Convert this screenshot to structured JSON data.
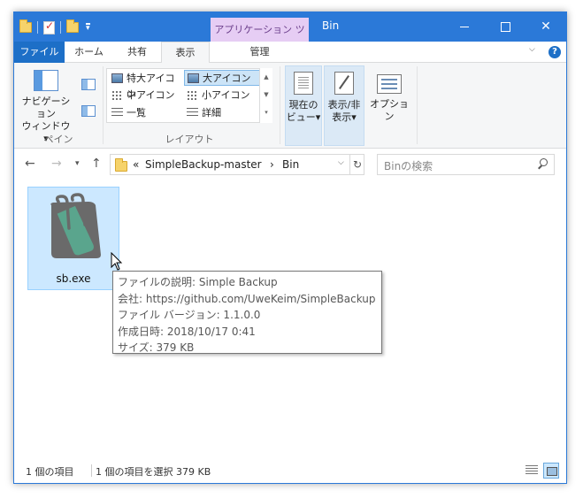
{
  "title_bar": {
    "window_title": "Bin",
    "context_tab_group": "アプリケーション ツール"
  },
  "ribbon_tabs": {
    "file": "ファイル",
    "home": "ホーム",
    "share": "共有",
    "view": "表示",
    "manage": "管理"
  },
  "ribbon": {
    "pane_group": {
      "label": "ペイン",
      "nav_pane_line1": "ナビゲーション",
      "nav_pane_line2": "ウィンドウ▾"
    },
    "layout_group": {
      "label": "レイアウト",
      "items": [
        "特大アイコン",
        "大アイコン",
        "中アイコン",
        "小アイコン",
        "一覧",
        "詳細"
      ],
      "selected": "大アイコン"
    },
    "current_view": {
      "line1": "現在の",
      "line2": "ビュー▾"
    },
    "show_hide": {
      "line1": "表示/非",
      "line2": "表示▾"
    },
    "options": {
      "label": "オプション"
    }
  },
  "address_bar": {
    "overflow": "«",
    "crumbs": [
      "SimpleBackup-master",
      "Bin"
    ],
    "separator": "›"
  },
  "search": {
    "placeholder": "Binの検索"
  },
  "files": [
    {
      "name": "sb.exe"
    }
  ],
  "tooltip": {
    "lines": [
      "ファイルの説明: Simple Backup",
      "会社: https://github.com/UweKeim/SimpleBackup",
      "ファイル バージョン: 1.1.0.0",
      "作成日時: 2018/10/17 0:41",
      "サイズ: 379 KB"
    ]
  },
  "status_bar": {
    "item_count": "1 個の項目",
    "selected": "1 個の項目を選択  379 KB"
  },
  "colors": {
    "accent": "#2b79d8",
    "file_tab": "#1d6fc7",
    "context_tab": "#e6cdf4",
    "selection": "#cce8ff"
  }
}
